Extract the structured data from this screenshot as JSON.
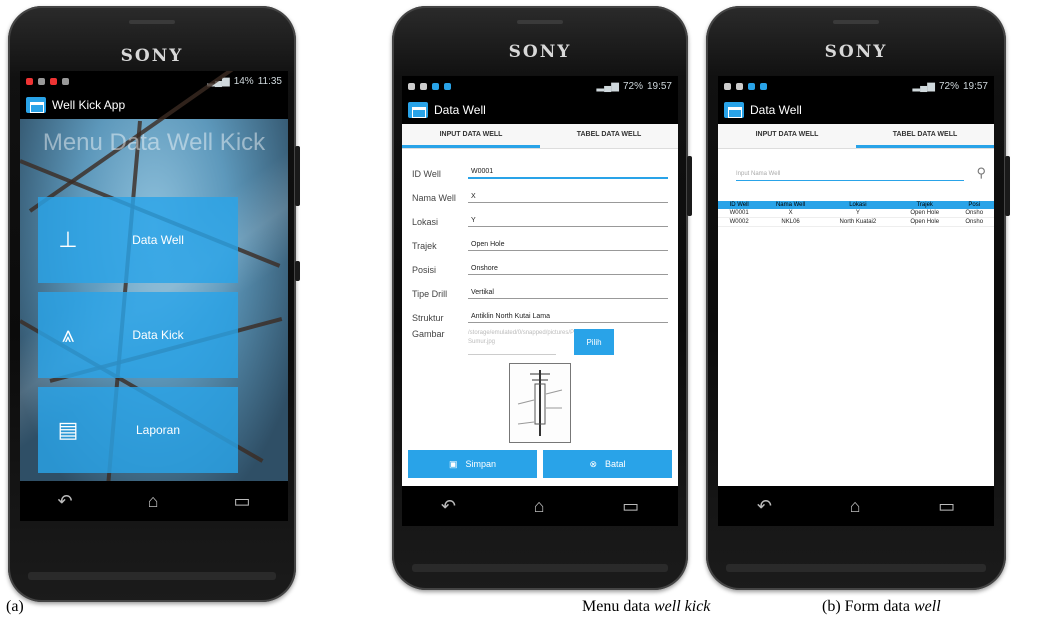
{
  "phone_brand": "SONY",
  "phone_a": {
    "status_time": "11:35",
    "status_battery": "14%",
    "app_title": "Well Kick App",
    "menu_title": "Menu Data Well Kick",
    "tiles": [
      {
        "label": "Data Well",
        "icon": "oil-rig-icon"
      },
      {
        "label": "Data Kick",
        "icon": "derrick-icon"
      },
      {
        "label": "Laporan",
        "icon": "documents-icon"
      }
    ]
  },
  "phone_b": {
    "status_time": "19:57",
    "status_battery": "72%",
    "app_title": "Data Well",
    "tabs": [
      "INPUT DATA WELL",
      "TABEL DATA WELL"
    ],
    "active_tab": 0,
    "fields": [
      {
        "label": "ID Well",
        "value": "W0001"
      },
      {
        "label": "Nama Well",
        "value": "X"
      },
      {
        "label": "Lokasi",
        "value": "Y"
      },
      {
        "label": "Trajek",
        "value": "Open Hole"
      },
      {
        "label": "Posisi",
        "value": "Onshore"
      },
      {
        "label": "Tipe Drill",
        "value": "Vertikal"
      },
      {
        "label": "Struktur",
        "value": "Antiklin North Kutai Lama"
      }
    ],
    "gambar_label": "Gambar",
    "gambar_path": "/storage/emulated/0/snapped/pictures/Profile Sumur.jpg",
    "pilih_label": "Pilih",
    "simpan_label": "Simpan",
    "batal_label": "Batal"
  },
  "phone_c": {
    "status_time": "19:57",
    "status_battery": "72%",
    "app_title": "Data Well",
    "tabs": [
      "INPUT DATA WELL",
      "TABEL DATA WELL"
    ],
    "active_tab": 1,
    "search_placeholder": "Input Nama Well",
    "table_headers": [
      "ID Well",
      "Nama Well",
      "Lokasi",
      "Trajek",
      "Posi"
    ],
    "table_rows": [
      [
        "W0001",
        "X",
        "Y",
        "Open Hole",
        "Onsho"
      ],
      [
        "W0002",
        "NKL06",
        "North Kuatai2",
        "Open Hole",
        "Onsho"
      ]
    ]
  },
  "captions": {
    "a_label": "(a)",
    "menu_caption": "Menu data well kick",
    "b_caption": "(b) Form data well"
  }
}
